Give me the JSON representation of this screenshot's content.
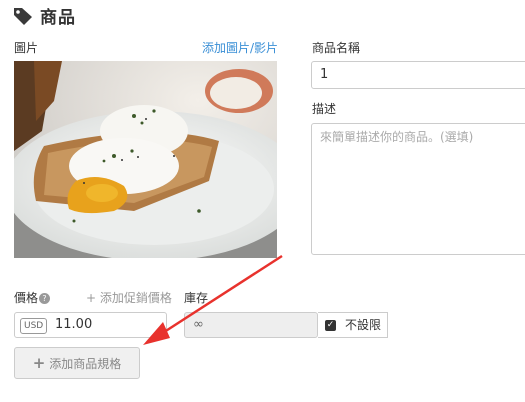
{
  "header": {
    "title": "商品",
    "icon": "tag-icon"
  },
  "image_section": {
    "label": "圖片",
    "add_link": "添加圖片/影片"
  },
  "name_section": {
    "label": "商品名稱",
    "value": "1"
  },
  "description_section": {
    "label": "描述",
    "placeholder": "來簡單描述你的商品。(選填)"
  },
  "price_section": {
    "label": "價格",
    "add_promo_link": "+ 添加促銷價格",
    "currency": "USD",
    "value": "11.00"
  },
  "stock_section": {
    "label": "庫存",
    "value": "∞",
    "unlimited_label": "不設限",
    "unlimited_checked": true
  },
  "add_variant_button": "添加商品規格",
  "colors": {
    "link": "#3a8fd6",
    "annotation_arrow": "#e8322d"
  }
}
